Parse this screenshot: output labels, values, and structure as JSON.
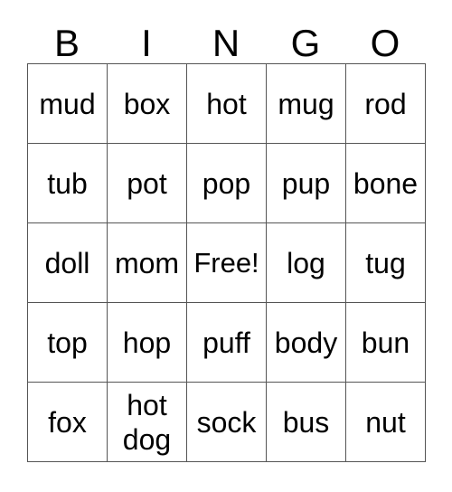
{
  "card": {
    "header_letters": [
      "B",
      "I",
      "N",
      "G",
      "O"
    ],
    "rows": [
      [
        "mud",
        "box",
        "hot",
        "mug",
        "rod"
      ],
      [
        "tub",
        "pot",
        "pop",
        "pup",
        "bone"
      ],
      [
        "doll",
        "mom",
        "Free!",
        "log",
        "tug"
      ],
      [
        "top",
        "hop",
        "puff",
        "body",
        "bun"
      ],
      [
        "fox",
        "hot dog",
        "sock",
        "bus",
        "nut"
      ]
    ],
    "free_space": {
      "row": 2,
      "column": 2,
      "label": "Free!"
    },
    "colors": {
      "background": "#ffffff",
      "text": "#000000",
      "grid_line": "#555555"
    }
  }
}
